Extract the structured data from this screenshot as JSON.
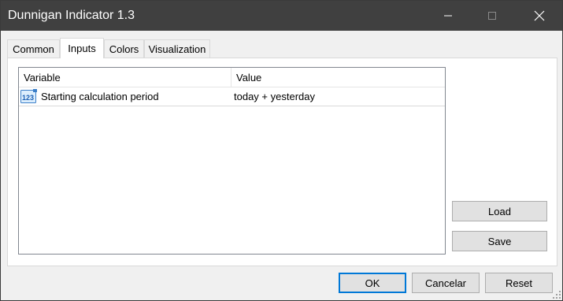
{
  "window": {
    "title": "Dunnigan Indicator 1.3"
  },
  "tabs": [
    {
      "label": "Common"
    },
    {
      "label": "Inputs"
    },
    {
      "label": "Colors"
    },
    {
      "label": "Visualization"
    }
  ],
  "active_tab": "Inputs",
  "inputs_table": {
    "columns": [
      "Variable",
      "Value"
    ],
    "rows": [
      {
        "icon": "numeric-123-icon",
        "variable": "Starting calculation period",
        "value": "today + yesterday"
      }
    ]
  },
  "side_buttons": {
    "load": "Load",
    "save": "Save"
  },
  "footer_buttons": {
    "ok": "OK",
    "cancel": "Cancelar",
    "reset": "Reset"
  },
  "colors": {
    "titlebar": "#404040",
    "default_button_border": "#0078d7"
  }
}
